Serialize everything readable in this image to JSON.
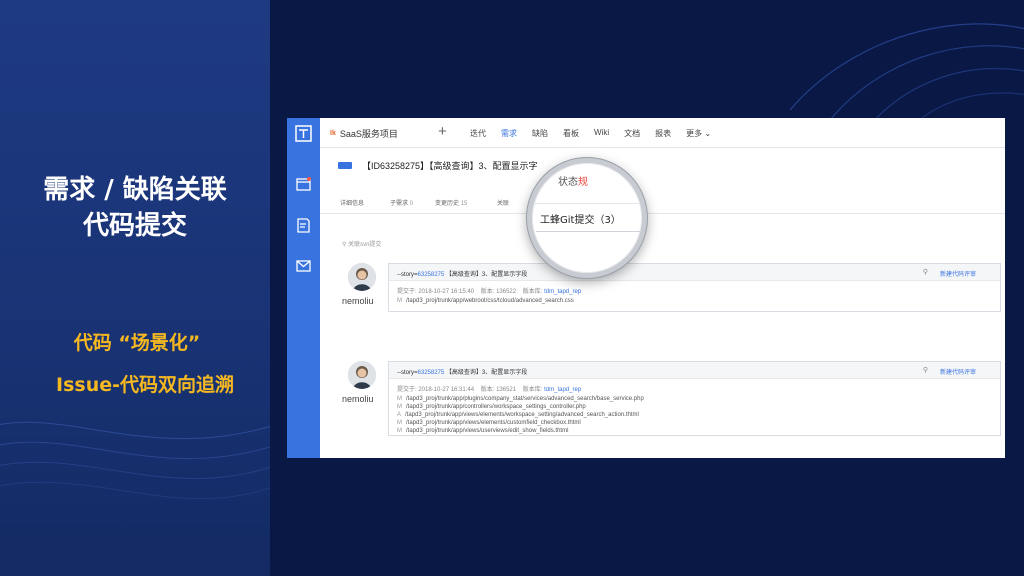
{
  "slide": {
    "title_line1": "需求 / 缺陷关联",
    "title_line2": "代码提交",
    "subtitle1": "代码  “场景化”",
    "subtitle2": "Issue-代码双向追溯"
  },
  "app": {
    "project_name": "SaaS服务项目",
    "project_logo": "Ik",
    "nav": [
      "迭代",
      "需求",
      "缺陷",
      "看板",
      "Wiki",
      "文档",
      "报表",
      "更多 ⌄"
    ],
    "active_nav": "需求",
    "story": {
      "title": "【ID63258275】【高级查询】3、配置显示字",
      "status_label": "状态",
      "status_value": ""
    },
    "tabs": [
      {
        "label": "详细信息",
        "count": ""
      },
      {
        "label": "子需求",
        "count": "0"
      },
      {
        "label": "变更历史",
        "count": "15"
      },
      {
        "label": "关联",
        "count": ""
      },
      {
        "label": "工蜂Git提交（3）",
        "count": ""
      }
    ],
    "search_placeholder": "关联svn提交",
    "commits": [
      {
        "author": "nemoliu",
        "head_prefix": "--story=",
        "head_link": "63258275",
        "head_text": "【高级查询】3、配置显示字段",
        "action": "新建代码评审",
        "meta_time": "提交于: 2018-10-27 16:15:40",
        "meta_rev": "版本: 136522",
        "meta_repo_label": "版本库:",
        "meta_repo": "tdm_tapd_rep",
        "paths": [
          {
            "mark": "M",
            "path": "/tapd3_proj/trunk/app/webroot/css/tcloud/advanced_search.css"
          }
        ]
      },
      {
        "author": "nemoliu",
        "head_prefix": "--story=",
        "head_link": "63258275",
        "head_text": "【高级查询】3、配置显示字段",
        "action": "新建代码评审",
        "meta_time": "提交于: 2018-10-27 16:31:44",
        "meta_rev": "版本: 136521",
        "meta_repo_label": "版本库:",
        "meta_repo": "tdm_tapd_rep",
        "paths": [
          {
            "mark": "M",
            "path": "/tapd3_proj/trunk/app/plugins/company_stat/services/advanced_search/base_service.php"
          },
          {
            "mark": "M",
            "path": "/tapd3_proj/trunk/app/controllers/workspace_settings_controller.php"
          },
          {
            "mark": "A",
            "path": "/tapd3_proj/trunk/app/views/elements/workspace_setting/advanced_search_action.thtml"
          },
          {
            "mark": "M",
            "path": "/tapd3_proj/trunk/app/views/elements/customfield_checkbox.thtml"
          },
          {
            "mark": "M",
            "path": "/tapd3_proj/trunk/app/views/userviews/edit_show_fields.thtml"
          }
        ]
      }
    ],
    "lens": {
      "status_text": "状态",
      "status_partial": "规",
      "tab_text": "工蜂Git提交（3）"
    }
  }
}
